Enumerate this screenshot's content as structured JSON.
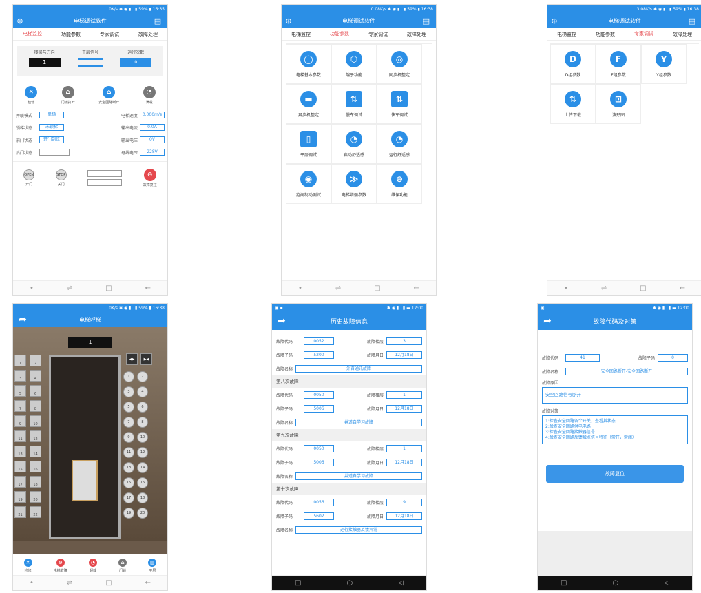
{
  "monitor": {
    "status": "0K/s ✱ ◉ ▮.. ▮ 59% ▮ 16:35",
    "title": "电梯调试软件",
    "tabs": [
      "电梯监控",
      "功能参数",
      "专家调试",
      "故障处理"
    ],
    "floor_label": "楼层与方向",
    "level_label": "平层信号",
    "runs_label": "运行次数",
    "floor": "1",
    "runs": "0",
    "buttons": [
      "检修",
      "门锁打开",
      "安全回路断开",
      "满载"
    ],
    "rows": [
      {
        "l": "并联模式",
        "v": "单梯",
        "l2": "电梯速度",
        "v2": "0.000m/s"
      },
      {
        "l": "锁梯状态",
        "v": "未锁梯",
        "l2": "输出电流",
        "v2": "0.0A"
      },
      {
        "l": "前门状态",
        "v": "开门到位",
        "l2": "输出电压",
        "v2": "0V"
      },
      {
        "l": "后门状态",
        "v": "",
        "l2": "母线电压",
        "v2": "228V"
      }
    ],
    "bottom": [
      "开门",
      "关门",
      "故障复位"
    ],
    "open_small": "OPEN",
    "stop_small": "STOP"
  },
  "func": {
    "status": "0.08K/s ✱ ◉ ▮.. ▮ 59% ▮ 16:38",
    "title": "电梯调试软件",
    "tabs": [
      "电梯监控",
      "功能参数",
      "专家调试",
      "故障处理"
    ],
    "items": [
      "电梯基本参数",
      "端子功能",
      "同步机整定",
      "异步机整定",
      "慢车调试",
      "快车调试",
      "平层调试",
      "启动舒适感",
      "运行舒适感",
      "抱闸制动测试",
      "电梯增强参数",
      "维保功能"
    ]
  },
  "expert": {
    "status": "3.08K/s ✱ ◉ ▮.. ▮ 59% ▮ 16:38",
    "title": "电梯调试软件",
    "tabs": [
      "电梯监控",
      "功能参数",
      "专家调试",
      "故障处理"
    ],
    "items": [
      {
        "g": "D",
        "t": "D组参数"
      },
      {
        "g": "F",
        "t": "F组参数"
      },
      {
        "g": "Y",
        "t": "Y组参数"
      },
      {
        "g": "⇅",
        "t": "上传下载"
      },
      {
        "g": "⊡",
        "t": "波形图"
      }
    ]
  },
  "call": {
    "status": "0K/s ✱ ◉ ▮.. ▮ 59% ▮ 16:38",
    "title": "电梯呼梯",
    "floor": "1",
    "left": [
      [
        "1",
        "2"
      ],
      [
        "3",
        "4"
      ],
      [
        "5",
        "6"
      ],
      [
        "7",
        "8"
      ],
      [
        "9",
        "10"
      ],
      [
        "11",
        "12"
      ],
      [
        "13",
        "14"
      ],
      [
        "15",
        "16"
      ],
      [
        "17",
        "18"
      ],
      [
        "19",
        "20"
      ],
      [
        "21",
        "22"
      ]
    ],
    "right": [
      [
        "1",
        "2"
      ],
      [
        "3",
        "4"
      ],
      [
        "5",
        "6"
      ],
      [
        "7",
        "8"
      ],
      [
        "9",
        "10"
      ],
      [
        "11",
        "12"
      ],
      [
        "13",
        "14"
      ],
      [
        "15",
        "16"
      ],
      [
        "17",
        "18"
      ],
      [
        "19",
        "20"
      ]
    ],
    "open_glyph": "◀▶",
    "close_glyph": "▶◀",
    "bottom": [
      "检修",
      "电梯故障",
      "超载",
      "门锁",
      "平层"
    ]
  },
  "history": {
    "status_left": "▣ ▪",
    "status": "✱ ◉ ▮.. ▮ ▬ 12:00",
    "title": "历史故障信息",
    "labels": {
      "code": "故障代码",
      "floor": "故障楼层",
      "sub": "故障子码",
      "date": "故障月日",
      "name": "故障名称"
    },
    "top": {
      "code": "0052",
      "floor": "3",
      "sub": "5200",
      "date": "12月18日",
      "name": "外召通讯故障"
    },
    "records": [
      {
        "head": "第八次故障",
        "code": "0050",
        "floor": "1",
        "sub": "5006",
        "date": "12月18日",
        "name": "井道自学习故障"
      },
      {
        "head": "第九次故障",
        "code": "0050",
        "floor": "1",
        "sub": "5006",
        "date": "12月18日",
        "name": "井道自学习故障"
      },
      {
        "head": "第十次故障",
        "code": "0056",
        "floor": "9",
        "sub": "5602",
        "date": "12月18日",
        "name": "运行接触器反馈异常"
      }
    ]
  },
  "fault": {
    "status_left": "▣",
    "status": "✱ ◉ ▮.. ▮ ▬ 12:00",
    "title": "故障代码及对策",
    "code_label": "故障代码",
    "code": "41",
    "sub_label": "故障子码",
    "sub": "0",
    "name_label": "故障名称",
    "name": "安全回路断开-安全回路断开",
    "reason_label": "故障原因",
    "reason": "安全回路信号断开",
    "measure_label": "故障对策",
    "measures": [
      "1:检查安全回路各个开关，查看其状态",
      "2:检查安全回路供电电路",
      "3:检查安全回路接触器信号",
      "4:检查安全回路反馈触点信号特征（常开，常闭）"
    ],
    "reset": "故障复位"
  },
  "nav": {
    "a": "•",
    "b": "⇌",
    "c": "□",
    "d": "←",
    "o": "○",
    "t": "◁"
  }
}
